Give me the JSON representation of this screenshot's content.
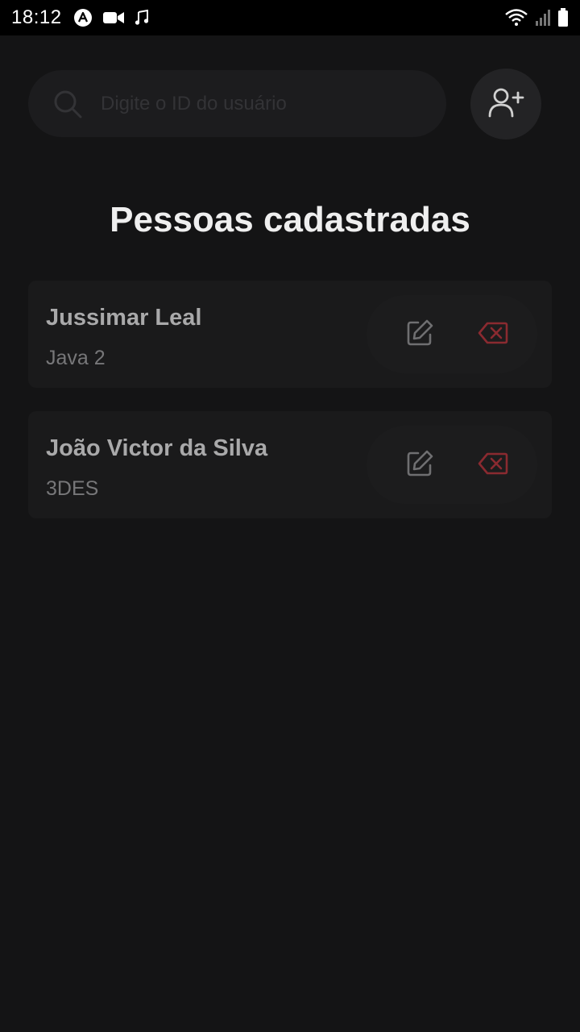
{
  "status_bar": {
    "time": "18:12",
    "left_icons": [
      "app-a-icon",
      "video-camera-icon",
      "music-note-icon"
    ],
    "right_icons": [
      "wifi-icon",
      "signal-icon",
      "battery-icon"
    ]
  },
  "search": {
    "placeholder": "Digite o ID do usuário",
    "value": ""
  },
  "header": {
    "title": "Pessoas cadastradas"
  },
  "people": [
    {
      "name": "Jussimar Leal",
      "course": "Java 2"
    },
    {
      "name": "João Victor da Silva",
      "course": "3DES"
    }
  ],
  "colors": {
    "background": "#141415",
    "card": "#1a1a1b",
    "edit_icon": "#6f6f71",
    "delete_icon": "#8a2a30"
  }
}
